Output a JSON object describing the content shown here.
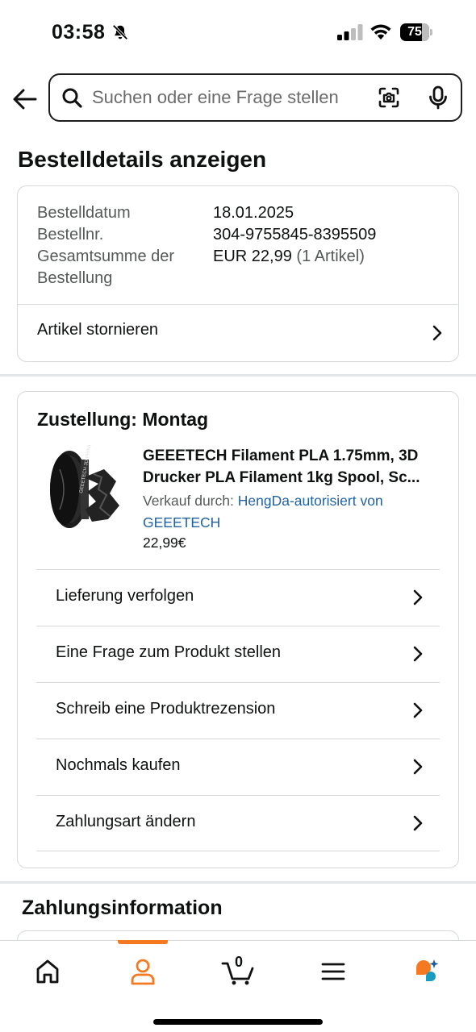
{
  "status_bar": {
    "time": "03:58",
    "battery": "75"
  },
  "search": {
    "placeholder": "Suchen oder eine Frage stellen"
  },
  "page": {
    "title": "Bestelldetails anzeigen"
  },
  "summary": {
    "rows": [
      {
        "label": "Bestelldatum",
        "value": "18.01.2025"
      },
      {
        "label": "Bestellnr.",
        "value": "304-9755845-8395509"
      },
      {
        "label": "Gesamtsumme der Bestellung",
        "value": "EUR 22,99",
        "value_suffix": "(1 Artikel)"
      }
    ],
    "cancel_label": "Artikel stornieren"
  },
  "delivery": {
    "title": "Zustellung: Montag",
    "product": {
      "title_line1": "GEEETECH Filament PLA 1.75mm, 3D",
      "title_line2": "Drucker PLA Filament 1kg Spool, Sc...",
      "sold_by_label": "Verkauf durch:",
      "seller_line1": "HengDa-autorisiert von",
      "seller_line2": "GEEETECH",
      "price": "22,99€",
      "image_text": "GEEETECH 3D PRINTER"
    },
    "actions": [
      {
        "label": "Lieferung verfolgen"
      },
      {
        "label": "Eine Frage zum Produkt stellen"
      },
      {
        "label": "Schreib eine Produktrezension"
      },
      {
        "label": "Nochmals kaufen"
      },
      {
        "label": "Zahlungsart ändern"
      }
    ]
  },
  "payment": {
    "title": "Zahlungsinformation"
  },
  "bottom_nav": {
    "items": [
      "home-icon",
      "account-icon",
      "cart-icon",
      "menu-icon",
      "rufus-chat-icon"
    ],
    "active": "account-icon",
    "cart_count": "0",
    "accent_color": "#f47920"
  },
  "colors": {
    "link": "#2162a1",
    "border": "#d5d9d9",
    "text": "#0f1111",
    "muted": "#565959"
  }
}
